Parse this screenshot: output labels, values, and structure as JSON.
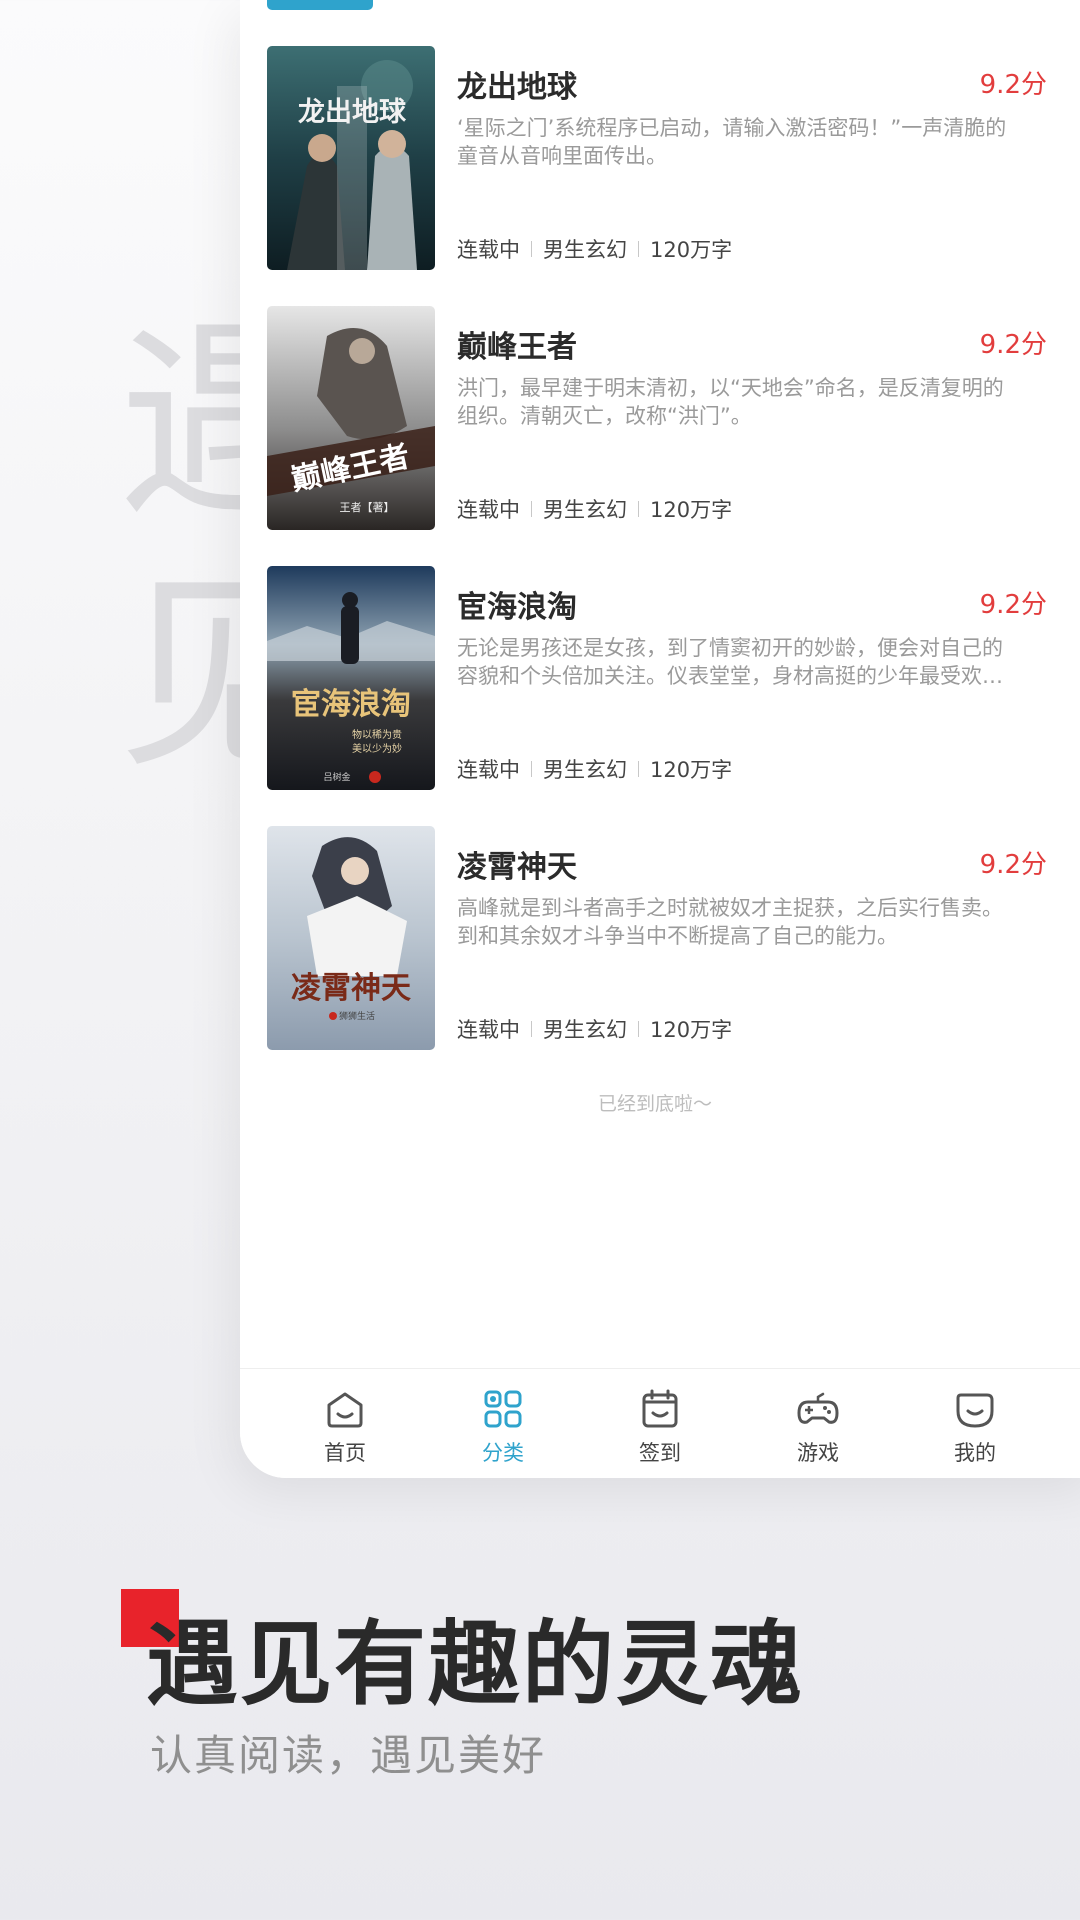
{
  "background_chars": [
    "遇",
    "见"
  ],
  "books": [
    {
      "title": "龙出地球",
      "score": "9.2分",
      "description": "‘星际之门’系统程序已启动，请输入激活密码！”一声清脆的童音从音响里面传出。",
      "status": "连载中",
      "category": "男生玄幻",
      "word_count": "120万字",
      "cover_text": "龙出地球"
    },
    {
      "title": "巅峰王者",
      "score": "9.2分",
      "description": "洪门，最早建于明末清初，以“天地会”命名，是反清复明的组织。清朝灭亡，改称“洪门”。",
      "status": "连载中",
      "category": "男生玄幻",
      "word_count": "120万字",
      "cover_text": "巅峰王者",
      "cover_author": "王者【著】"
    },
    {
      "title": "宦海浪淘",
      "score": "9.2分",
      "description": "无论是男孩还是女孩，到了情窦初开的妙龄，便会对自己的容貌和个头倍加关注。仪表堂堂，身材高挺的少年最受欢迎。",
      "status": "连载中",
      "category": "男生玄幻",
      "word_count": "120万字",
      "cover_text": "宦海浪淘",
      "cover_sub1": "物以稀为贵",
      "cover_sub2": "美以少为妙",
      "cover_author": "吕树金"
    },
    {
      "title": "凌霄神天",
      "score": "9.2分",
      "description": "高峰就是到斗者高手之时就被奴才主捉获，之后实行售卖。到和其余奴才斗争当中不断提高了自己的能力。",
      "status": "连载中",
      "category": "男生玄幻",
      "word_count": "120万字",
      "cover_text": "凌霄神天",
      "cover_author": "狮狮生活"
    }
  ],
  "end_hint": "已经到底啦～",
  "tabbar": [
    {
      "label": "首页",
      "icon": "home-icon",
      "active": false
    },
    {
      "label": "分类",
      "icon": "category-grid-icon",
      "active": true
    },
    {
      "label": "签到",
      "icon": "calendar-checkin-icon",
      "active": false
    },
    {
      "label": "游戏",
      "icon": "gamepad-icon",
      "active": false
    },
    {
      "label": "我的",
      "icon": "profile-icon",
      "active": false
    }
  ],
  "headline": "遇见有趣的灵魂",
  "subline": "认真阅读，遇见美好",
  "colors": {
    "accent": "#2fa3cc",
    "score": "#e23d3d",
    "promo_square": "#e8232b"
  }
}
